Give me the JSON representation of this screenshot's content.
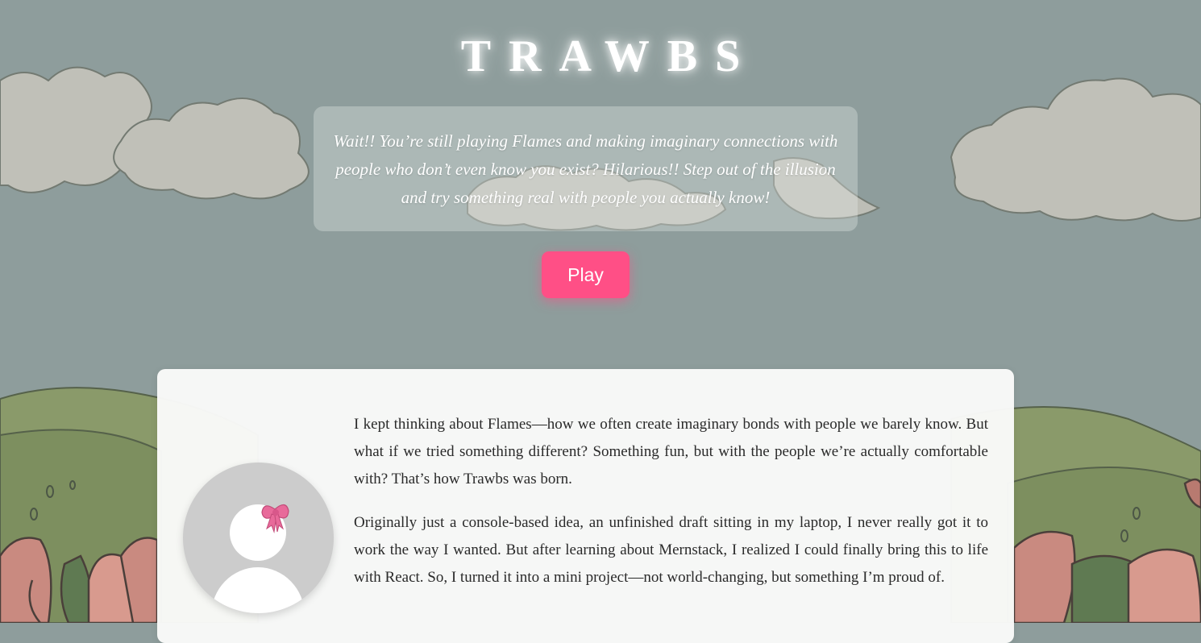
{
  "header": {
    "title": "TRAWBS",
    "intro": "Wait!! You’re still playing Flames and making imaginary connections with people who don’t even know you exist? Hilarious!! Step out of the illusion and try something real with people you actually know!"
  },
  "play_button": {
    "label": "Play"
  },
  "about": {
    "avatar_icon": "avatar-with-bow-icon",
    "paragraphs": [
      "I kept thinking about Flames—how we often create imaginary bonds with people we barely know. But what if we tried something different? Something fun, but with the people we’re actually comfortable with? That’s how Trawbs was born.",
      "Originally just a console-based idea, an unfinished draft sitting in my laptop, I never really got it to work the way I wanted. But after learning about Mernstack, I realized I could finally bring this to life with React. So, I turned it into a mini project—not world-changing, but something I’m proud of."
    ]
  },
  "colors": {
    "accent": "#ff4f86",
    "sky": "#8e9d9c",
    "hills": "#8a9a6a",
    "tulips": "#c98a80"
  }
}
